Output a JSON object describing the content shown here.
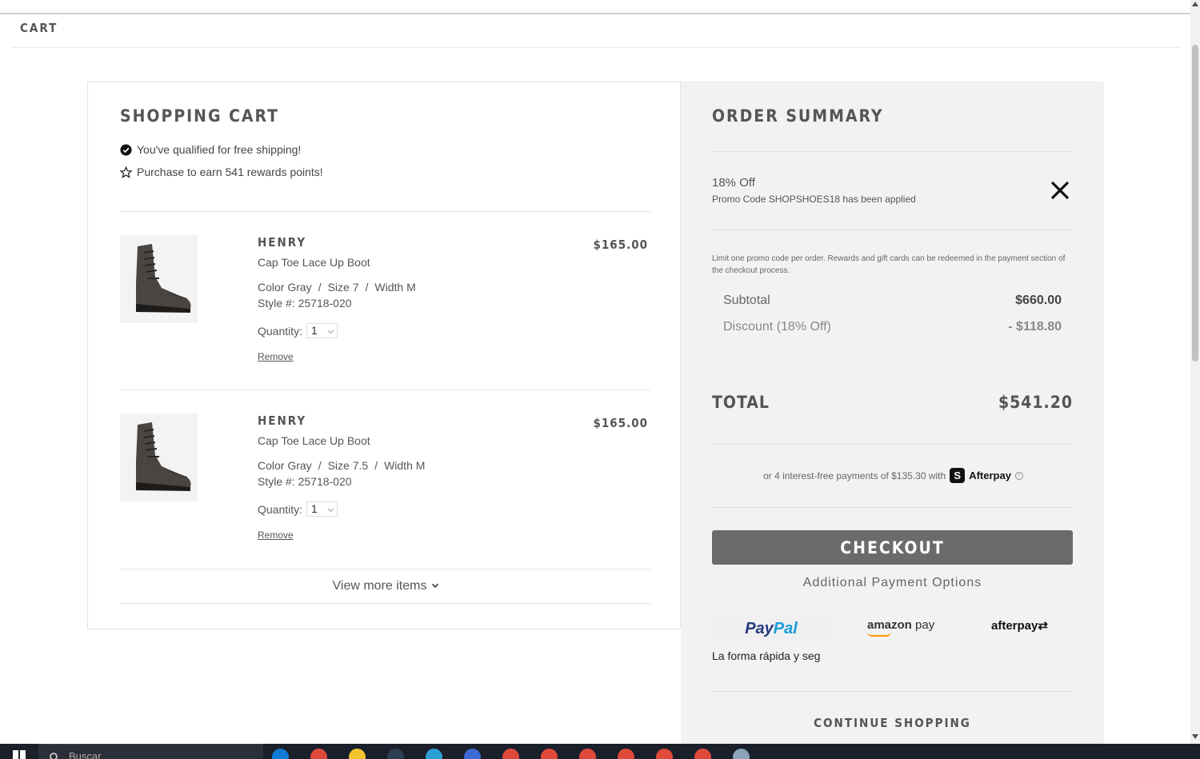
{
  "header": {
    "breadcrumb": "CART"
  },
  "cart": {
    "title": "SHOPPING CART",
    "perks": [
      {
        "icon": "check-circle-icon",
        "text": "You've qualified for free shipping!"
      },
      {
        "icon": "star-icon",
        "text": "Purchase to earn 541 rewards points!"
      }
    ],
    "items": [
      {
        "brand": "HENRY",
        "name": "Cap Toe Lace Up Boot",
        "color": "Color Gray",
        "size": "Size 7",
        "width": "Width M",
        "style": "Style #: 25718-020",
        "quantity_label": "Quantity:",
        "quantity": "1",
        "price": "$165.00",
        "remove_label": "Remove"
      },
      {
        "brand": "HENRY",
        "name": "Cap Toe Lace Up Boot",
        "color": "Color Gray",
        "size": "Size 7.5",
        "width": "Width M",
        "style": "Style #: 25718-020",
        "quantity_label": "Quantity:",
        "quantity": "1",
        "price": "$165.00",
        "remove_label": "Remove"
      }
    ],
    "view_more": "View more items"
  },
  "summary": {
    "title": "ORDER SUMMARY",
    "promo": {
      "name": "18% Off",
      "message": "Promo Code SHOPSHOES18 has been applied"
    },
    "limit_note": "Limit one promo code per order. Rewards and gift cards can be redeemed in the payment section of the checkout process.",
    "subtotal_label": "Subtotal",
    "subtotal": "$660.00",
    "discount_label": "Discount (18% Off)",
    "discount": "- $118.80",
    "total_label": "TOTAL",
    "total": "$541.20",
    "afterpay_text": "or 4 interest-free payments of $135.30 with",
    "afterpay_badge": "S",
    "afterpay_word": "Afterpay",
    "checkout_label": "CHECKOUT",
    "additional_label": "Additional Payment Options",
    "paypal_a": "Pay",
    "paypal_b": "Pal",
    "paypal_tagline": "La forma rápida y seg",
    "amazon_a": "amazon",
    "amazon_b": " pay",
    "afterpay_btn": "afterpay",
    "continue_label": "CONTINUE SHOPPING"
  },
  "taskbar": {
    "search_placeholder": "Buscar",
    "icon_colors": [
      "#0f7ad6",
      "#e04a3a",
      "#f4c430",
      "#2c3e50",
      "#2a9fd6",
      "#3d6ad6",
      "#e04a3a",
      "#e04a3a",
      "#e04a3a",
      "#e04a3a",
      "#e04a3a",
      "#e04a3a",
      "#8aa3b8"
    ]
  },
  "colors": {
    "checkout": "#6b6b6b",
    "summary_bg": "#f2f2f2",
    "paypal_dark": "#253b80",
    "paypal_light": "#179bd7"
  }
}
